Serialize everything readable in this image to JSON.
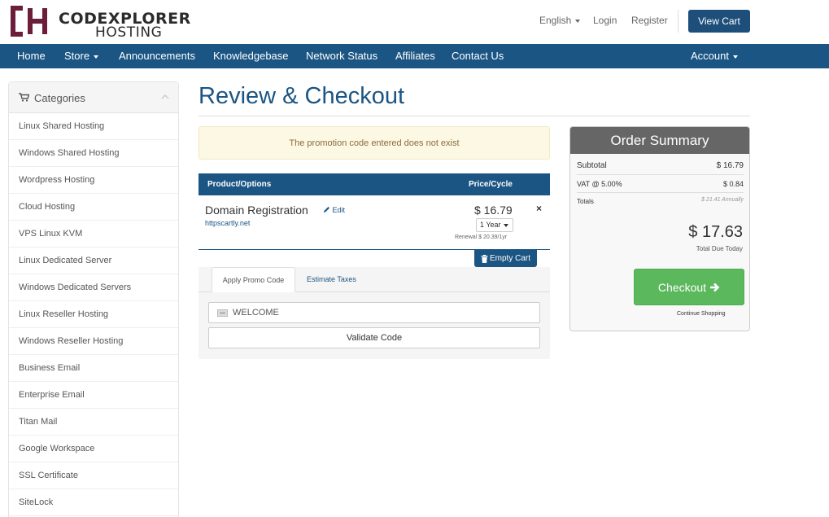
{
  "brand": {
    "name_line1": "CODEXPLORER",
    "name_line2": "HOSTING",
    "mark_color": "#6b1d3a"
  },
  "top_links": {
    "language": "English",
    "login": "Login",
    "register": "Register",
    "view_cart": "View Cart"
  },
  "nav": {
    "items": [
      "Home",
      "Store",
      "Announcements",
      "Knowledgebase",
      "Network Status",
      "Affiliates",
      "Contact Us"
    ],
    "account": "Account",
    "bg_color": "#1b5583"
  },
  "sidebar": {
    "title": "Categories",
    "items": [
      "Linux Shared Hosting",
      "Windows Shared Hosting",
      "Wordpress Hosting",
      "Cloud Hosting",
      "VPS Linux KVM",
      "Linux Dedicated Server",
      "Windows Dedicated Servers",
      "Linux Reseller Hosting",
      "Windows Reseller Hosting",
      "Business Email",
      "Enterprise Email",
      "Titan Mail",
      "Google Workspace",
      "SSL Certificate",
      "SiteLock"
    ]
  },
  "page": {
    "title": "Review & Checkout"
  },
  "alert": {
    "text": "The promotion code entered does not exist"
  },
  "cart": {
    "col_product": "Product/Options",
    "col_price": "Price/Cycle",
    "item": {
      "name": "Domain Registration",
      "edit": "Edit",
      "domain": "httpscartly.net",
      "price": "$ 16.79",
      "cycle": "1 Year",
      "renewal": "Renewal $ 20.39/1yr",
      "remove": "×"
    },
    "empty_cart": "Empty Cart"
  },
  "promo": {
    "tab_promo": "Apply Promo Code",
    "tab_taxes": "Estimate Taxes",
    "code_value": "WELCOME",
    "validate": "Validate Code"
  },
  "summary": {
    "title": "Order Summary",
    "subtotal_label": "Subtotal",
    "subtotal_value": "$ 16.79",
    "vat_label": "VAT @ 5.00%",
    "vat_value": "$ 0.84",
    "totals_label": "Totals",
    "totals_value": "$ 21.41 Annually",
    "total_due": "$ 17.63",
    "total_due_label": "Total Due Today",
    "checkout": "Checkout",
    "continue": "Continue Shopping",
    "checkout_color": "#5cb85c"
  }
}
